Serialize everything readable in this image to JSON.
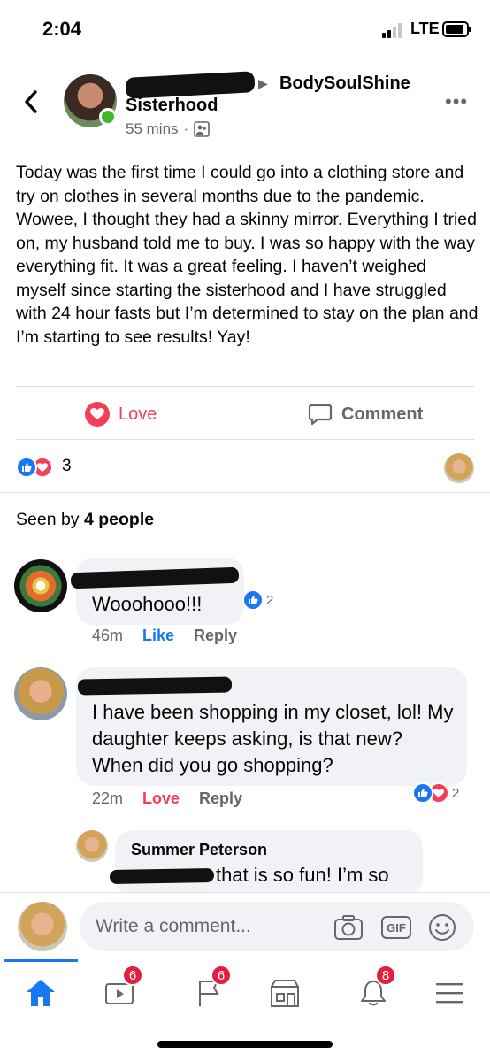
{
  "status_bar": {
    "time": "2:04",
    "network": "LTE"
  },
  "post": {
    "author_redacted": true,
    "group_name_line1": "BodySoulShine",
    "group_name_line2": "Sisterhood",
    "time_ago": "55 mins",
    "meta_sep": "·",
    "body": "Today was the first time I could go into a clothing store and try on clothes in several months due to the pandemic. Wowee, I thought they had a skinny mirror. Everything I tried on, my husband told me to buy. I was so happy with the way everything fit. It was a great feeling. I haven’t weighed myself since starting the sisterhood and I have struggled with 24 hour fasts but I’m determined to stay on the plan and I’m starting to see results! Yay!"
  },
  "actions": {
    "love_label": "Love",
    "comment_label": "Comment"
  },
  "reactions": {
    "count": "3"
  },
  "seen_by": {
    "prefix": "Seen by ",
    "count_text": "4 people"
  },
  "comments": [
    {
      "text": "Wooohooo!!!",
      "time": "46m",
      "like_label": "Like",
      "reply_label": "Reply",
      "reaction_count": "2"
    },
    {
      "text": "I have been shopping in my closet, lol! My daughter keeps asking, is that new? When did you go shopping?",
      "time": "22m",
      "like_label": "Love",
      "reply_label": "Reply",
      "reaction_count": "2"
    }
  ],
  "reply": {
    "name": "Summer Peterson",
    "text": "that is so fun! I’m so"
  },
  "composer": {
    "placeholder": "Write a comment...",
    "gif_label": "GIF"
  },
  "tabbar": {
    "badges": {
      "watch": "6",
      "groups": "6",
      "notifications": "8"
    }
  },
  "colors": {
    "accent": "#1877f2",
    "love": "#f33e58",
    "badge": "#e41e3f"
  }
}
